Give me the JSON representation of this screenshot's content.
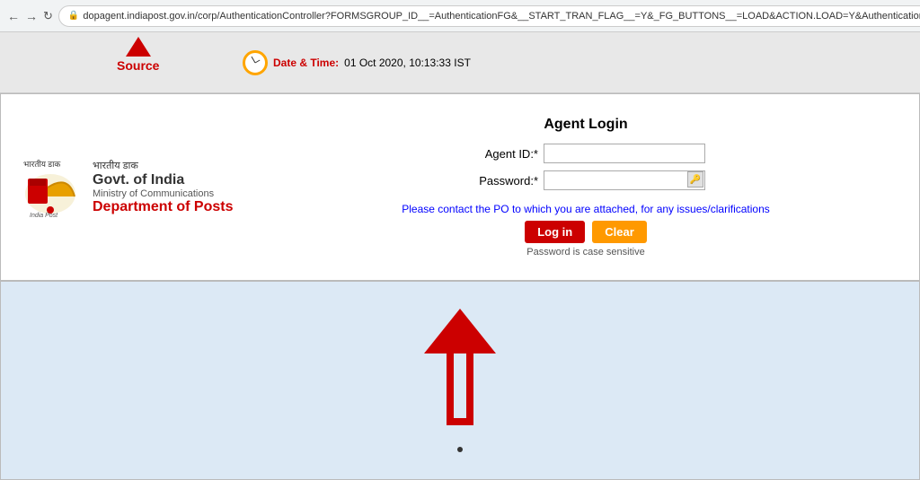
{
  "browser": {
    "url": "dopagent.indiapost.gov.in/corp/AuthenticationController?FORMSGROUP_ID__=AuthenticationFG&__START_TRAN_FLAG__=Y&_FG_BUTTONS__=LOAD&ACTION.LOAD=Y&AuthenticationFG.i"
  },
  "annotation_bar": {
    "source_label": "Source",
    "datetime_label": "Date & Time:",
    "datetime_value": "01 Oct 2020, 10:13:33 IST"
  },
  "logo": {
    "govt_line": "Govt. of India",
    "ministry_line": "Ministry of Communications",
    "dept_line": "Department of Posts",
    "india_post_label": "India Post"
  },
  "login_form": {
    "title": "Agent Login",
    "agent_id_label": "Agent ID:*",
    "password_label": "Password:*",
    "contact_msg": "Please contact the PO to which you are attached, for any issues/clarifications",
    "login_btn": "Log in",
    "clear_btn": "Clear",
    "case_msg": "Password is case sensitive"
  },
  "bottom": {
    "dot": "."
  }
}
